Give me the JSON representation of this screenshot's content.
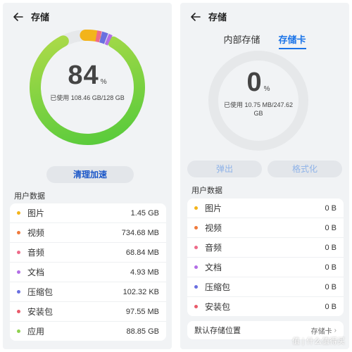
{
  "left": {
    "title": "存储",
    "ring": {
      "percent": "84",
      "percent_sign": "%",
      "used": "已使用 108.46 GB/128 GB",
      "fraction": 0.84
    },
    "clean_button": "清理加速",
    "section": "用户数据",
    "items": [
      {
        "label": "图片",
        "size": "1.45 GB",
        "color": "#f3b41b"
      },
      {
        "label": "视频",
        "size": "734.68 MB",
        "color": "#f07a3c"
      },
      {
        "label": "音频",
        "size": "68.84 MB",
        "color": "#ee6b8a"
      },
      {
        "label": "文档",
        "size": "4.93 MB",
        "color": "#b26ee6"
      },
      {
        "label": "压缩包",
        "size": "102.32 KB",
        "color": "#6a6fe0"
      },
      {
        "label": "安装包",
        "size": "97.55 MB",
        "color": "#e95a6a"
      },
      {
        "label": "应用",
        "size": "88.85 GB",
        "color": "#8fd14f"
      }
    ]
  },
  "right": {
    "title": "存储",
    "tabs": [
      "内部存储",
      "存储卡"
    ],
    "ring": {
      "percent": "0",
      "percent_sign": "%",
      "used": "已使用 10.75 MB/247.62 GB",
      "fraction": 0
    },
    "eject_button": "弹出",
    "format_button": "格式化",
    "section": "用户数据",
    "items": [
      {
        "label": "图片",
        "size": "0 B",
        "color": "#f3b41b"
      },
      {
        "label": "视频",
        "size": "0 B",
        "color": "#f07a3c"
      },
      {
        "label": "音频",
        "size": "0 B",
        "color": "#ee6b8a"
      },
      {
        "label": "文档",
        "size": "0 B",
        "color": "#b26ee6"
      },
      {
        "label": "压缩包",
        "size": "0 B",
        "color": "#6a6fe0"
      },
      {
        "label": "安装包",
        "size": "0 B",
        "color": "#e95a6a"
      }
    ],
    "default_location_label": "默认存储位置",
    "default_location_value": "存储卡"
  },
  "watermark": "值 | 什么值得买"
}
